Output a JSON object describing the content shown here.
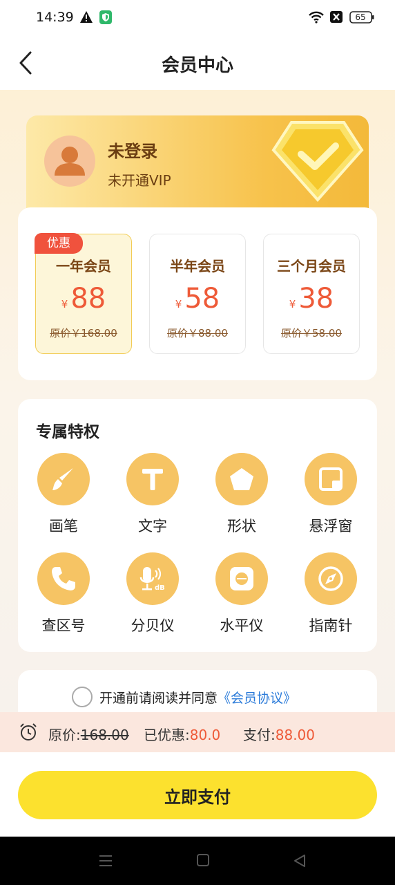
{
  "status": {
    "time": "14:39",
    "battery": "65"
  },
  "nav": {
    "title": "会员中心"
  },
  "user": {
    "name": "未登录",
    "vip_status": "未开通VIP"
  },
  "plans": [
    {
      "name": "一年会员",
      "currency": "¥",
      "price": "88",
      "original": "原价￥168.00",
      "tag": "优惠",
      "selected": true
    },
    {
      "name": "半年会员",
      "currency": "¥",
      "price": "58",
      "original": "原价￥88.00"
    },
    {
      "name": "三个月会员",
      "currency": "¥",
      "price": "38",
      "original": "原价￥58.00"
    }
  ],
  "privileges": {
    "title": "专属特权",
    "items": [
      {
        "label": "画笔",
        "icon": "brush-icon"
      },
      {
        "label": "文字",
        "icon": "text-icon"
      },
      {
        "label": "形状",
        "icon": "pentagon-icon"
      },
      {
        "label": "悬浮窗",
        "icon": "floating-window-icon"
      },
      {
        "label": "查区号",
        "icon": "phone-icon"
      },
      {
        "label": "分贝仪",
        "icon": "decibel-meter-icon"
      },
      {
        "label": "水平仪",
        "icon": "level-icon"
      },
      {
        "label": "指南针",
        "icon": "compass-icon"
      }
    ]
  },
  "agreement": {
    "text": "开通前请阅读并同意",
    "link": "《会员协议》"
  },
  "summary": {
    "original_label": "原价:",
    "original_value": "168.00",
    "discount_label": "已优惠:",
    "discount_value": "80.0",
    "pay_label": "支付:",
    "pay_value": "88.00"
  },
  "pay_button": "立即支付",
  "colors": {
    "accent": "#ee5a38",
    "brand_yellow": "#fce12e",
    "icon_orange": "#f6c464",
    "link": "#2b7bd9"
  }
}
